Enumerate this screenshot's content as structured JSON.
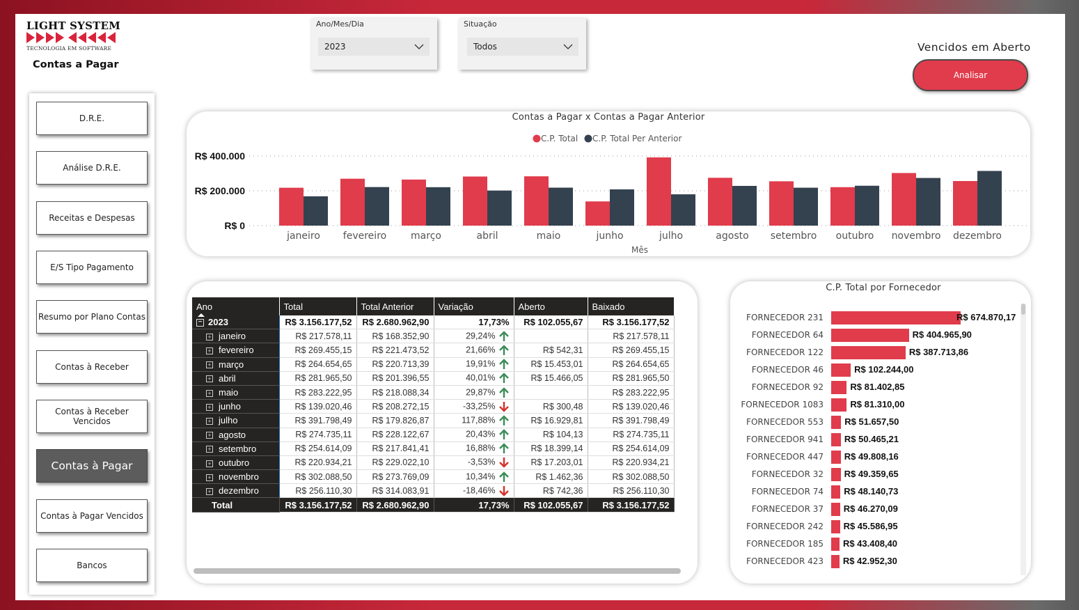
{
  "brand": {
    "name": "LIGHT SYSTEM",
    "tagline": "TECNOLOGIA EM SOFTWARE",
    "page_title": "Contas a Pagar"
  },
  "filters": {
    "date": {
      "label": "Ano/Mes/Dia",
      "value": "2023"
    },
    "situacao": {
      "label": "Situação",
      "value": "Todos"
    }
  },
  "vencidos": {
    "title": "Vencidos em Aberto",
    "button": "Analisar"
  },
  "nav": {
    "items": [
      {
        "label": "D.R.E.",
        "active": false
      },
      {
        "label": "Análise D.R.E.",
        "active": false
      },
      {
        "label": "Receitas e Despesas",
        "active": false
      },
      {
        "label": "E/S Tipo Pagamento",
        "active": false
      },
      {
        "label": "Resumo por Plano Contas",
        "active": false
      },
      {
        "label": "Contas à Receber",
        "active": false
      },
      {
        "label": "Contas à Receber Vencidos",
        "active": false
      },
      {
        "label": "Contas à Pagar",
        "active": true
      },
      {
        "label": "Contas à Pagar Vencidos",
        "active": false
      },
      {
        "label": "Bancos",
        "active": false
      }
    ]
  },
  "colors": {
    "red": "#e03c4c",
    "dark": "#34424f",
    "header": "#252423",
    "up": "#3d8c5a",
    "down": "#d6342c"
  },
  "chart_data": [
    {
      "type": "bar",
      "title": "Contas a Pagar x Contas a Pagar Anterior",
      "xlabel": "Mês",
      "ylabel": "",
      "categories": [
        "janeiro",
        "fevereiro",
        "março",
        "abril",
        "maio",
        "junho",
        "julho",
        "agosto",
        "setembro",
        "outubro",
        "novembro",
        "dezembro"
      ],
      "series": [
        {
          "name": "C.P. Total",
          "color": "#e03c4c",
          "values": [
            217578.11,
            269455.15,
            264654.65,
            281965.5,
            283222.95,
            139020.46,
            391798.49,
            274735.11,
            254614.09,
            220934.21,
            302088.5,
            256110.3
          ]
        },
        {
          "name": "C.P. Total Per Anterior",
          "color": "#34424f",
          "values": [
            168352.9,
            221473.52,
            220713.39,
            201396.55,
            218088.34,
            208272.15,
            179826.87,
            228122.67,
            217841.41,
            229022.1,
            273769.09,
            314083.91
          ]
        }
      ],
      "yticks": [
        "R$ 0",
        "R$ 200.000",
        "R$ 400.000"
      ],
      "ylim": [
        0,
        400000
      ],
      "grid": true,
      "legend": "top-center"
    },
    {
      "type": "bar",
      "orientation": "horizontal",
      "title": "C.P. Total por Fornecedor",
      "categories": [
        "FORNECEDOR 231",
        "FORNECEDOR 64",
        "FORNECEDOR 122",
        "FORNECEDOR 46",
        "FORNECEDOR 92",
        "FORNECEDOR 1083",
        "FORNECEDOR 553",
        "FORNECEDOR 941",
        "FORNECEDOR 447",
        "FORNECEDOR 32",
        "FORNECEDOR 74",
        "FORNECEDOR 37",
        "FORNECEDOR 242",
        "FORNECEDOR 185",
        "FORNECEDOR 423"
      ],
      "values": [
        674870.17,
        404965.9,
        387713.86,
        102244.0,
        81402.85,
        81310.0,
        51657.5,
        50465.21,
        49808.16,
        49359.65,
        48140.73,
        46270.09,
        45586.95,
        43408.4,
        42952.3
      ],
      "labels": [
        "R$ 674.870,17",
        "R$ 404.965,90",
        "R$ 387.713,86",
        "R$ 102.244,00",
        "R$ 81.402,85",
        "R$ 81.310,00",
        "R$ 51.657,50",
        "R$ 50.465,21",
        "R$ 49.808,16",
        "R$ 49.359,65",
        "R$ 48.140,73",
        "R$ 46.270,09",
        "R$ 45.586,95",
        "R$ 43.408,40",
        "R$ 42.952,30"
      ],
      "color": "#e03c4c"
    }
  ],
  "matrix": {
    "columns": [
      "Ano",
      "Total",
      "Total Anterior",
      "Variação",
      "Aberto",
      "Baixado"
    ],
    "year_row": {
      "label": "2023",
      "total": "R$ 3.156.177,52",
      "anterior": "R$ 2.680.962,90",
      "variacao": "17,73%",
      "aberto": "R$ 102.055,67",
      "baixado": "R$ 3.156.177,52"
    },
    "rows": [
      {
        "label": "janeiro",
        "total": "R$ 217.578,11",
        "anterior": "R$ 168.352,90",
        "variacao": "29,24%",
        "trend": "up",
        "aberto": "",
        "baixado": "R$ 217.578,11"
      },
      {
        "label": "fevereiro",
        "total": "R$ 269.455,15",
        "anterior": "R$ 221.473,52",
        "variacao": "21,66%",
        "trend": "up",
        "aberto": "R$ 542,31",
        "baixado": "R$ 269.455,15"
      },
      {
        "label": "março",
        "total": "R$ 264.654,65",
        "anterior": "R$ 220.713,39",
        "variacao": "19,91%",
        "trend": "up",
        "aberto": "R$ 15.453,01",
        "baixado": "R$ 264.654,65"
      },
      {
        "label": "abril",
        "total": "R$ 281.965,50",
        "anterior": "R$ 201.396,55",
        "variacao": "40,01%",
        "trend": "up",
        "aberto": "R$ 15.466,05",
        "baixado": "R$ 281.965,50"
      },
      {
        "label": "maio",
        "total": "R$ 283.222,95",
        "anterior": "R$ 218.088,34",
        "variacao": "29,87%",
        "trend": "up",
        "aberto": "",
        "baixado": "R$ 283.222,95"
      },
      {
        "label": "junho",
        "total": "R$ 139.020,46",
        "anterior": "R$ 208.272,15",
        "variacao": "-33,25%",
        "trend": "down",
        "aberto": "R$ 300,48",
        "baixado": "R$ 139.020,46"
      },
      {
        "label": "julho",
        "total": "R$ 391.798,49",
        "anterior": "R$ 179.826,87",
        "variacao": "117,88%",
        "trend": "up",
        "aberto": "R$ 16.929,81",
        "baixado": "R$ 391.798,49"
      },
      {
        "label": "agosto",
        "total": "R$ 274.735,11",
        "anterior": "R$ 228.122,67",
        "variacao": "20,43%",
        "trend": "up",
        "aberto": "R$ 104,13",
        "baixado": "R$ 274.735,11"
      },
      {
        "label": "setembro",
        "total": "R$ 254.614,09",
        "anterior": "R$ 217.841,41",
        "variacao": "16,88%",
        "trend": "up",
        "aberto": "R$ 18.399,14",
        "baixado": "R$ 254.614,09"
      },
      {
        "label": "outubro",
        "total": "R$ 220.934,21",
        "anterior": "R$ 229.022,10",
        "variacao": "-3,53%",
        "trend": "down",
        "aberto": "R$ 17.203,01",
        "baixado": "R$ 220.934,21"
      },
      {
        "label": "novembro",
        "total": "R$ 302.088,50",
        "anterior": "R$ 273.769,09",
        "variacao": "10,34%",
        "trend": "up",
        "aberto": "R$ 1.462,36",
        "baixado": "R$ 302.088,50"
      },
      {
        "label": "dezembro",
        "total": "R$ 256.110,30",
        "anterior": "R$ 314.083,91",
        "variacao": "-18,46%",
        "trend": "down",
        "aberto": "R$ 742,36",
        "baixado": "R$ 256.110,30"
      }
    ],
    "total_row": {
      "label": "Total",
      "total": "R$ 3.156.177,52",
      "anterior": "R$ 2.680.962,90",
      "variacao": "17,73%",
      "aberto": "R$ 102.055,67",
      "baixado": "R$ 3.156.177,52"
    }
  }
}
